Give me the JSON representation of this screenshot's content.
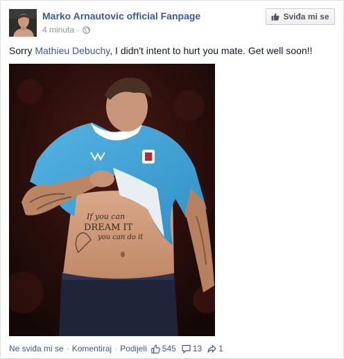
{
  "post": {
    "page_name": "Marko Arnautovic official Fanpage",
    "time": "4 minuta",
    "separator": "·",
    "like_page_button": "Sviđa mi se",
    "message_before": "Sorry ",
    "message_mention": "Mathieu Debuchy",
    "message_after": ", I didn't intent to hurt you mate. Get well soon!!",
    "photo_text": {
      "line1": "If you can",
      "line2": "DREAM IT",
      "line3": "you can do it"
    }
  },
  "actions": {
    "unlike": "Ne sviđa mi se",
    "comment": "Komentiraj",
    "share": "Podijeli",
    "sep": "·"
  },
  "counts": {
    "likes": "545",
    "comments": "13",
    "shares": "1"
  },
  "colors": {
    "link": "#3b5998",
    "meta": "#90949c",
    "text": "#141823",
    "shirt": "#3fa4d6"
  },
  "icons": {
    "audience": "globe-icon",
    "like_button": "thumbs-up-icon",
    "likes": "thumbs-up-outline-icon",
    "comments": "comment-icon",
    "shares": "share-arrow-icon"
  }
}
